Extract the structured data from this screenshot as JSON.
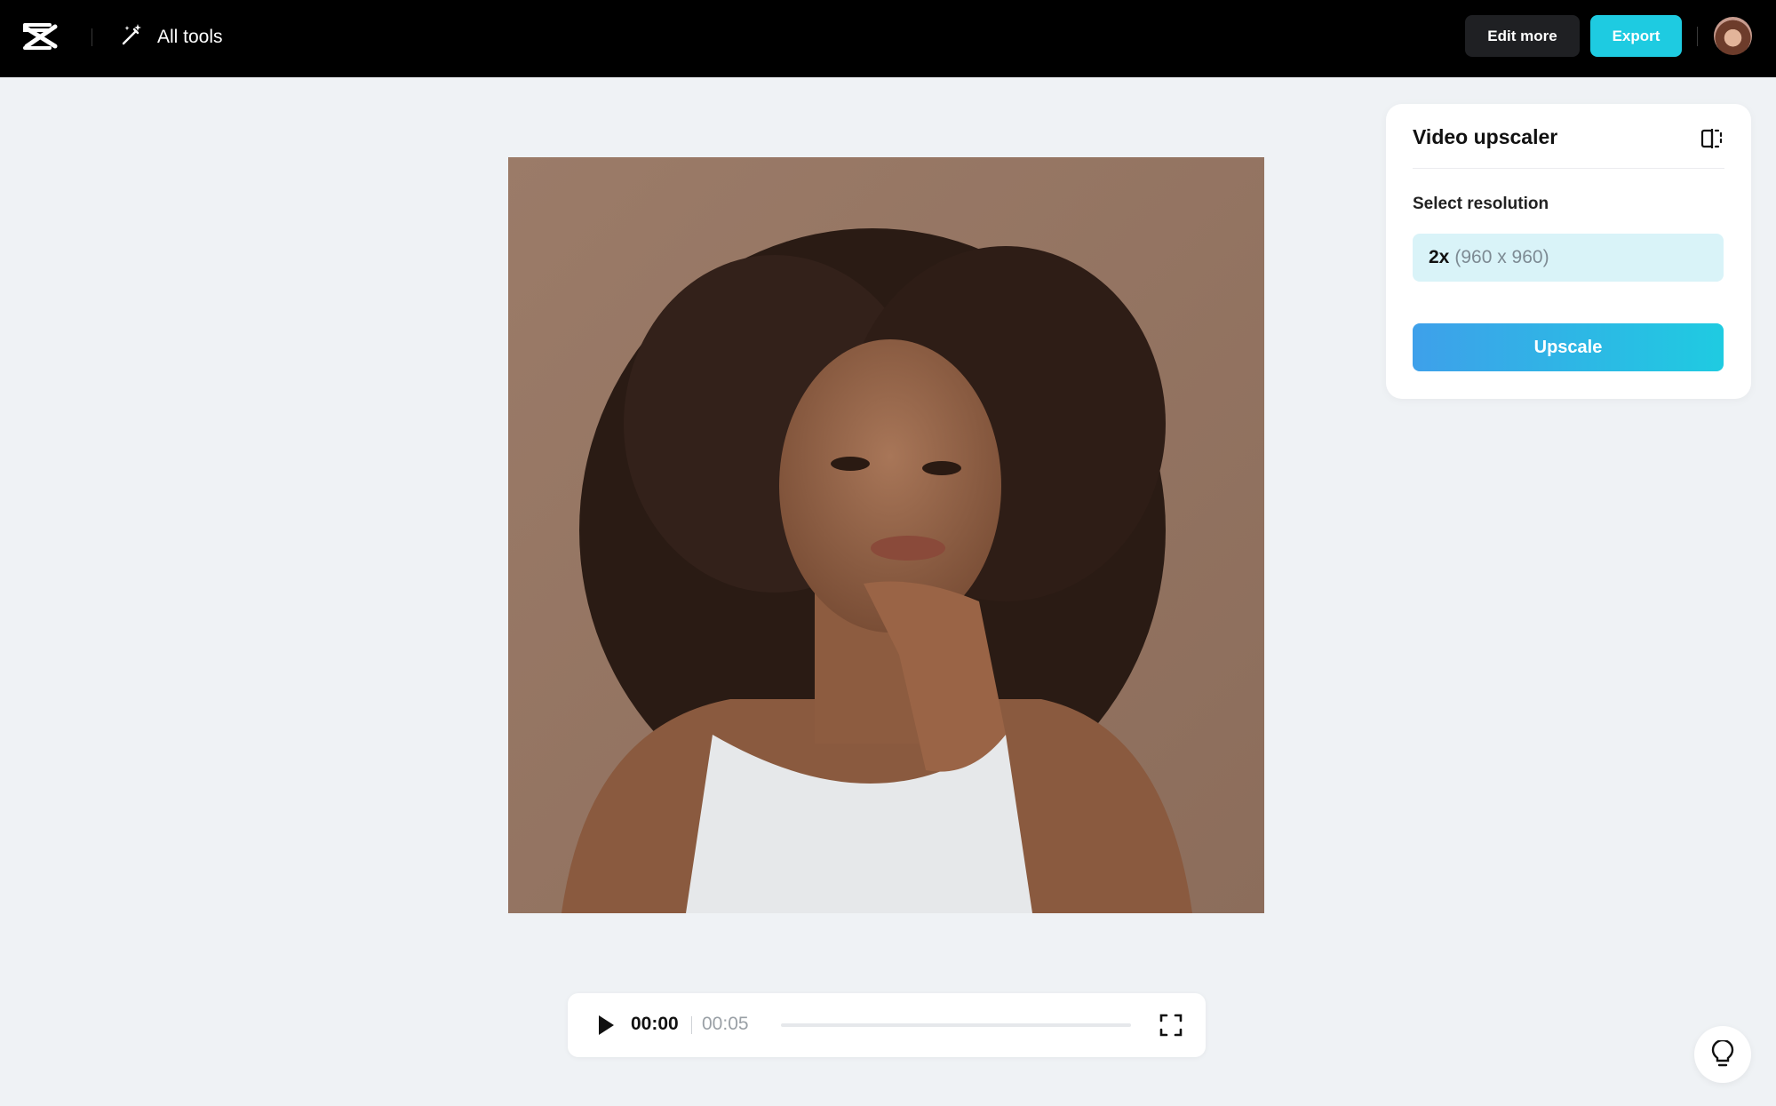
{
  "topbar": {
    "logo_icon": "capcut-logo-icon",
    "all_tools_icon": "magic-wand-icon",
    "all_tools_label": "All tools",
    "edit_more_label": "Edit more",
    "export_label": "Export",
    "avatar_icon": "user-avatar"
  },
  "preview": {
    "content": "portrait-video-frame"
  },
  "player": {
    "play_icon": "play-icon",
    "current_time": "00:00",
    "total_time": "00:05",
    "progress": 0,
    "fullscreen_icon": "fullscreen-icon"
  },
  "panel": {
    "title": "Video upscaler",
    "compare_icon": "split-compare-icon",
    "resolution_label": "Select resolution",
    "resolution_factor": "2x",
    "resolution_dims": "(960 x 960)",
    "upscale_label": "Upscale"
  },
  "help": {
    "icon": "lightbulb-icon"
  },
  "colors": {
    "accent": "#1ecbe1",
    "topbar": "#000000",
    "background": "#eff2f5",
    "select_bg": "#d9f3f8",
    "upscale_gradient_start": "#3ea0ea",
    "upscale_gradient_end": "#1fcbe1"
  }
}
